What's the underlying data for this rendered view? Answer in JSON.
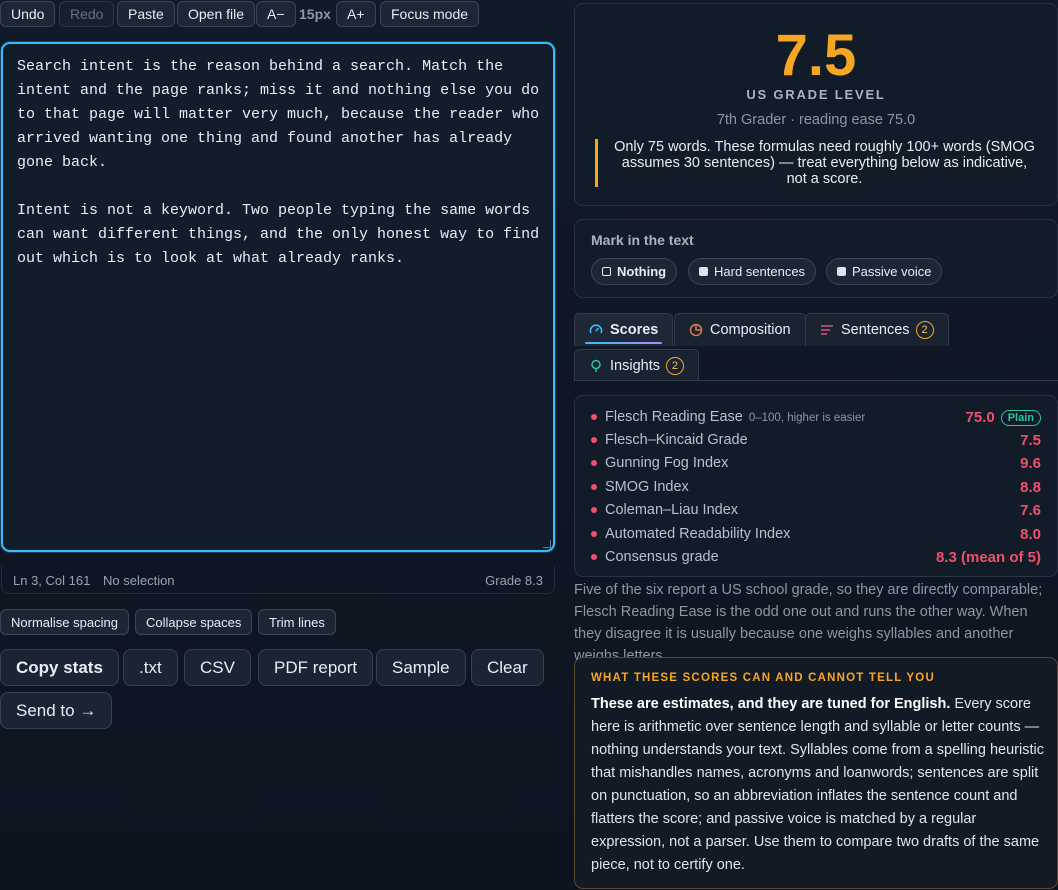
{
  "toolbar": {
    "undo": "Undo",
    "redo": "Redo",
    "paste": "Paste",
    "open_file": "Open file",
    "font_decrease": "A−",
    "font_size": "15px",
    "font_increase": "A+",
    "focus_mode": "Focus mode"
  },
  "editor": {
    "text": "Search intent is the reason behind a search. Match the intent and the page ranks; miss it and nothing else you do to that page will matter very much, because the reader who arrived wanting one thing and found another has already gone back.\n\nIntent is not a keyword. Two people typing the same words can want different things, and the only honest way to find out which is to look at what already ranks."
  },
  "status": {
    "position": "Ln 3, Col 161",
    "selection": "No selection",
    "grade": "Grade 8.3"
  },
  "tools": {
    "normalise": "Normalise spacing",
    "collapse": "Collapse spaces",
    "trim": "Trim lines"
  },
  "actions": {
    "copy_stats": "Copy stats",
    "txt": ".txt",
    "csv": "CSV",
    "pdf": "PDF report",
    "sample": "Sample",
    "clear": "Clear",
    "send": "Send to →"
  },
  "summary": {
    "grade": "7.5",
    "label": "US GRADE LEVEL",
    "sub": "7th Grader · reading ease 75.0",
    "warning": "Only 75 words. These formulas need roughly 100+ words (SMOG assumes 30 sentences) — treat everything below as indicative, not a score."
  },
  "mark": {
    "title": "Mark in the text",
    "options": [
      "Nothing",
      "Hard sentences",
      "Passive voice"
    ],
    "selected": "Nothing"
  },
  "tabs": [
    {
      "label": "Scores",
      "icon": "gauge-icon",
      "active": true
    },
    {
      "label": "Composition",
      "icon": "pie-chart-icon"
    },
    {
      "label": "Sentences",
      "icon": "lines-icon",
      "count": "2"
    },
    {
      "label": "Insights",
      "icon": "lightbulb-icon",
      "count": "2"
    }
  ],
  "scores": [
    {
      "name": "Flesch Reading Ease",
      "hint": "0–100, higher is easier",
      "value": "75.0",
      "badge": "Plain"
    },
    {
      "name": "Flesch–Kincaid Grade",
      "value": "7.5"
    },
    {
      "name": "Gunning Fog Index",
      "value": "9.6"
    },
    {
      "name": "SMOG Index",
      "value": "8.8"
    },
    {
      "name": "Coleman–Liau Index",
      "value": "7.6"
    },
    {
      "name": "Automated Readability Index",
      "value": "8.0"
    },
    {
      "name": "Consensus grade",
      "value": "8.3 (mean of 5)"
    }
  ],
  "note": "Five of the six report a US school grade, so they are directly comparable; Flesch Reading Ease is the odd one out and runs the other way. When they disagree it is usually because one weighs syllables and another weighs letters.",
  "caveat": {
    "title": "WHAT THESE SCORES CAN AND CANNOT TELL YOU",
    "lead": "These are estimates, and they are tuned for English.",
    "body": " Every score here is arithmetic over sentence length and syllable or letter counts — nothing understands your text. Syllables come from a spelling heuristic that mishandles names, acronyms and loanwords; sentences are split on punctuation, so an abbreviation inflates the sentence count and flatters the score; and passive voice is matched by a regular expression, not a parser. Use them to compare two drafts of the same piece, not to certify one."
  },
  "colors": {
    "accent": "#38bdf8",
    "grade": "#f5a623",
    "score": "#f0506e",
    "plain": "#2cc69b"
  }
}
